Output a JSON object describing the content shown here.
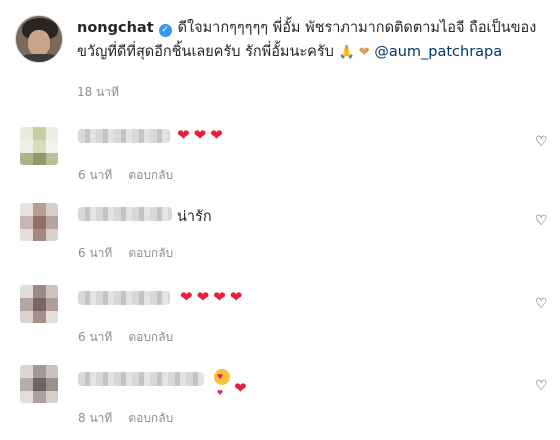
{
  "post": {
    "username": "nongchat",
    "verified_icon": "verified-badge-icon",
    "caption_part1": "ดีใจมากๆๆๆๆๆ พี่อั้ม พัชราภามากดติดตามไอจี ถือเป็นของ",
    "caption_part2": "ขวัญที่ดีที่สุดอีกชิ้นเลยครับ รักพี่อั้มนะครับ",
    "caption_emoji": "🙏 ❤",
    "mention": "@aum_patchrapa",
    "time": "18 นาที"
  },
  "comments": [
    {
      "text": "",
      "emoji": "❤❤❤",
      "time": "6 นาที",
      "reply_label": "ตอบกลับ",
      "like_icon": "heart-outline-icon"
    },
    {
      "text": "น่ารัก",
      "emoji": "",
      "time": "6 นาที",
      "reply_label": "ตอบกลับ",
      "like_icon": "heart-outline-icon"
    },
    {
      "text": "",
      "emoji": "❤❤❤❤",
      "time": "6 นาที",
      "reply_label": "ตอบกลับ",
      "like_icon": "heart-outline-icon"
    },
    {
      "text": "",
      "emoji": "😍❤",
      "time": "8 นาที",
      "reply_label": "ตอบกลับ",
      "like_icon": "heart-outline-icon"
    }
  ],
  "colors": {
    "accent_link": "#00376b",
    "verified": "#3897f0",
    "heart": "#ed1c3c",
    "muted": "#8e8e8e"
  }
}
